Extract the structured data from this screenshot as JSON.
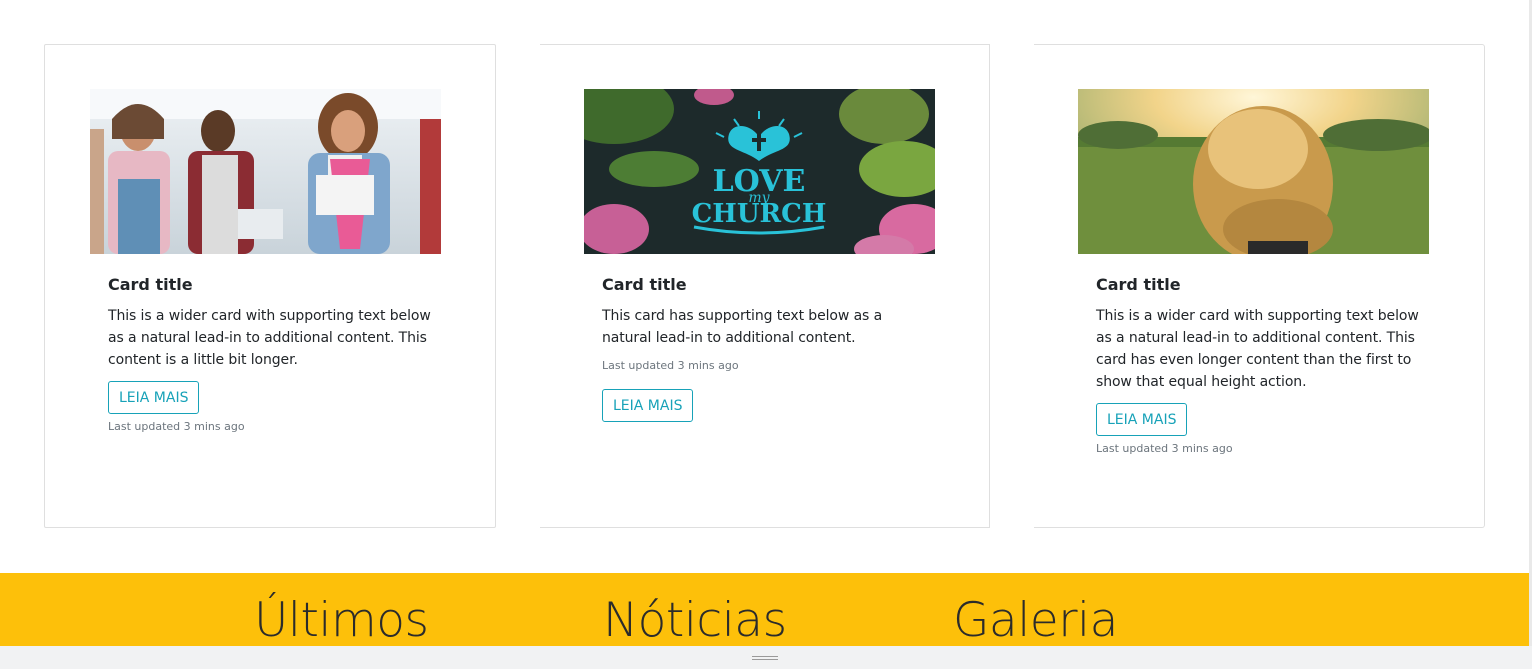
{
  "cards": [
    {
      "image": "students-group-photo",
      "title": "Card title",
      "text": "This is a wider card with supporting text below as a natural lead-in to additional content. This content is a little bit longer.",
      "button_label": "LEIA MAIS",
      "updated": "Last updated 3 mins ago"
    },
    {
      "image": "love-my-church-graphic",
      "title": "Card title",
      "text": "This card has supporting text below as a natural lead-in to additional content.",
      "button_label": "LEIA MAIS",
      "updated": "Last updated 3 mins ago"
    },
    {
      "image": "woman-in-sunlit-field-photo",
      "title": "Card title",
      "text": "This is a wider card with supporting text below as a natural lead-in to additional content. This card has even longer content than the first to show that equal height action.",
      "button_label": "LEIA MAIS",
      "updated": "Last updated 3 mins ago"
    }
  ],
  "band": {
    "items": [
      "Últimos",
      "Nóticias",
      "Galeria"
    ]
  },
  "colors": {
    "accent": "#17a2b8",
    "band": "#fdc00a",
    "text": "#212529",
    "muted": "#6c757d"
  }
}
